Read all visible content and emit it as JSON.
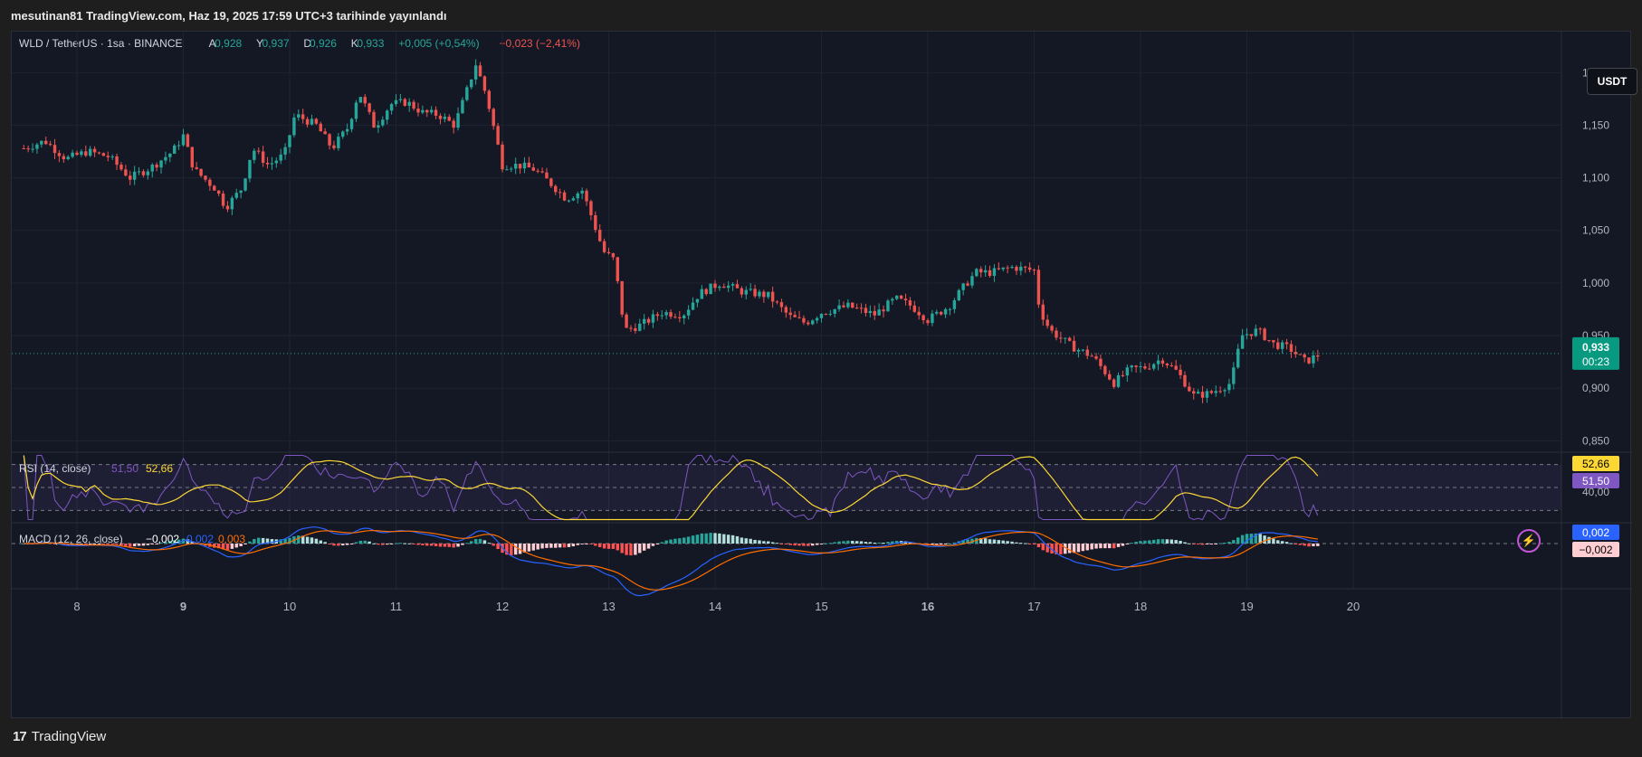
{
  "publisher": "mesutinan81 TradingView.com, Haz 19, 2025 17:59 UTC+3 tarihinde yayınlandı",
  "header": {
    "symbol": "WLD / TetherUS · 1sa · BINANCE",
    "o_label": "A",
    "o_value": "0,928",
    "h_label": "Y",
    "h_value": "0,937",
    "l_label": "D",
    "l_value": "0,926",
    "c_label": "K",
    "c_value": "0,933",
    "change": "+0,005 (+0,54%)",
    "change2": "−0,023 (−2,41%)"
  },
  "currency_button": "USDT",
  "footer_brand": "TradingView",
  "colors": {
    "up": "#26a69a",
    "down": "#ef5350",
    "rsi": "#7e57c2",
    "rsi_ma": "#fdd835",
    "macd": "#2962ff",
    "signal": "#ff6d00"
  },
  "chart_data": {
    "type": "candlestick",
    "title": "WLD / TetherUS · 1sa · BINANCE",
    "x_ticks": [
      "8",
      "9",
      "10",
      "11",
      "12",
      "13",
      "14",
      "15",
      "16",
      "17",
      "18",
      "19",
      "20"
    ],
    "price_ticks": [
      "1,200",
      "1,150",
      "1,100",
      "1,050",
      "1,000",
      "0,950",
      "0,900",
      "0,850"
    ],
    "ylim": [
      0.84,
      1.22
    ],
    "last_price": "0,933",
    "countdown": "00:23",
    "close_series": {
      "note": "hourly closes, approximate, read from chart",
      "x_day_start": 7.5,
      "step_hours": 1,
      "anchors": [
        [
          7.5,
          1.128
        ],
        [
          7.7,
          1.135
        ],
        [
          7.9,
          1.118
        ],
        [
          8.1,
          1.125
        ],
        [
          8.3,
          1.12
        ],
        [
          8.5,
          1.1
        ],
        [
          8.7,
          1.11
        ],
        [
          8.9,
          1.125
        ],
        [
          9.0,
          1.14
        ],
        [
          9.1,
          1.108
        ],
        [
          9.3,
          1.09
        ],
        [
          9.4,
          1.072
        ],
        [
          9.55,
          1.09
        ],
        [
          9.65,
          1.128
        ],
        [
          9.8,
          1.112
        ],
        [
          9.95,
          1.122
        ],
        [
          10.05,
          1.16
        ],
        [
          10.25,
          1.15
        ],
        [
          10.4,
          1.128
        ],
        [
          10.55,
          1.148
        ],
        [
          10.65,
          1.182
        ],
        [
          10.8,
          1.148
        ],
        [
          10.95,
          1.17
        ],
        [
          11.1,
          1.172
        ],
        [
          11.25,
          1.162
        ],
        [
          11.4,
          1.16
        ],
        [
          11.55,
          1.15
        ],
        [
          11.65,
          1.178
        ],
        [
          11.75,
          1.208
        ],
        [
          11.85,
          1.178
        ],
        [
          12.0,
          1.112
        ],
        [
          12.15,
          1.112
        ],
        [
          12.3,
          1.108
        ],
        [
          12.45,
          1.095
        ],
        [
          12.6,
          1.08
        ],
        [
          12.75,
          1.088
        ],
        [
          12.85,
          1.06
        ],
        [
          12.95,
          1.03
        ],
        [
          13.05,
          1.022
        ],
        [
          13.15,
          0.955
        ],
        [
          13.3,
          0.96
        ],
        [
          13.5,
          0.972
        ],
        [
          13.7,
          0.97
        ],
        [
          13.85,
          0.99
        ],
        [
          14.05,
          1.0
        ],
        [
          14.25,
          0.992
        ],
        [
          14.5,
          0.988
        ],
        [
          14.7,
          0.968
        ],
        [
          14.85,
          0.962
        ],
        [
          15.0,
          0.972
        ],
        [
          15.25,
          0.978
        ],
        [
          15.5,
          0.97
        ],
        [
          15.7,
          0.985
        ],
        [
          15.85,
          0.978
        ],
        [
          16.0,
          0.965
        ],
        [
          16.2,
          0.978
        ],
        [
          16.35,
          0.998
        ],
        [
          16.45,
          1.01
        ],
        [
          16.6,
          1.01
        ],
        [
          16.8,
          1.015
        ],
        [
          17.0,
          1.012
        ],
        [
          17.05,
          0.975
        ],
        [
          17.15,
          0.955
        ],
        [
          17.35,
          0.94
        ],
        [
          17.55,
          0.93
        ],
        [
          17.75,
          0.905
        ],
        [
          17.9,
          0.918
        ],
        [
          18.05,
          0.92
        ],
        [
          18.2,
          0.928
        ],
        [
          18.35,
          0.915
        ],
        [
          18.5,
          0.893
        ],
        [
          18.65,
          0.895
        ],
        [
          18.85,
          0.905
        ],
        [
          18.95,
          0.95
        ],
        [
          19.1,
          0.955
        ],
        [
          19.25,
          0.942
        ],
        [
          19.4,
          0.938
        ],
        [
          19.55,
          0.925
        ],
        [
          19.7,
          0.933
        ]
      ]
    },
    "rsi": {
      "label": "RSI (14, close)",
      "value": "51,50",
      "ma_value": "52,66",
      "ticks": [
        "40,00"
      ],
      "ylim": [
        20,
        80
      ],
      "bands": [
        70,
        50,
        30
      ]
    },
    "macd": {
      "label": "MACD (12, 26, close)",
      "macd_value": "−0,002",
      "signal_value": "0,002",
      "hist_value": "0,003",
      "badge_macd": "0,002",
      "badge_neg": "−0,002"
    }
  }
}
